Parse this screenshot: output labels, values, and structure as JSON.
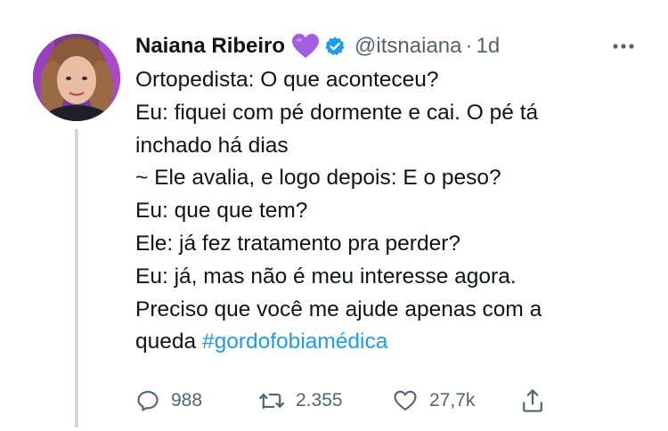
{
  "tweet": {
    "author_name": "Naiana Ribeiro",
    "name_emoji": "purple-heart-emoji",
    "verified_icon": "verified-badge-icon",
    "handle": "@itsnaiana",
    "separator": "·",
    "time": "1d",
    "more_icon": "more-horizontal-icon",
    "lines": [
      "Ortopedista: O que aconteceu?",
      "Eu: fiquei com pé dormente e cai. O pé tá",
      "inchado há dias",
      "~ Ele avalia, e logo depois: E o peso?",
      "Eu: que que tem?",
      "Ele: já fez tratamento pra perder?",
      "Eu: já, mas não é meu interesse agora.",
      "Preciso que você me ajude apenas com a"
    ],
    "last_line_text": "queda ",
    "hashtag": "#gordofobiamédica"
  },
  "actions": {
    "reply_count": "988",
    "retweet_count": "2.355",
    "like_count": "27,7k"
  },
  "colors": {
    "text": "#0f1419",
    "secondary": "#536471",
    "link": "#1d9bf0",
    "verified": "#1d9bf0",
    "emoji_heart": "#a45de0",
    "thread_line": "#cfd9de"
  }
}
